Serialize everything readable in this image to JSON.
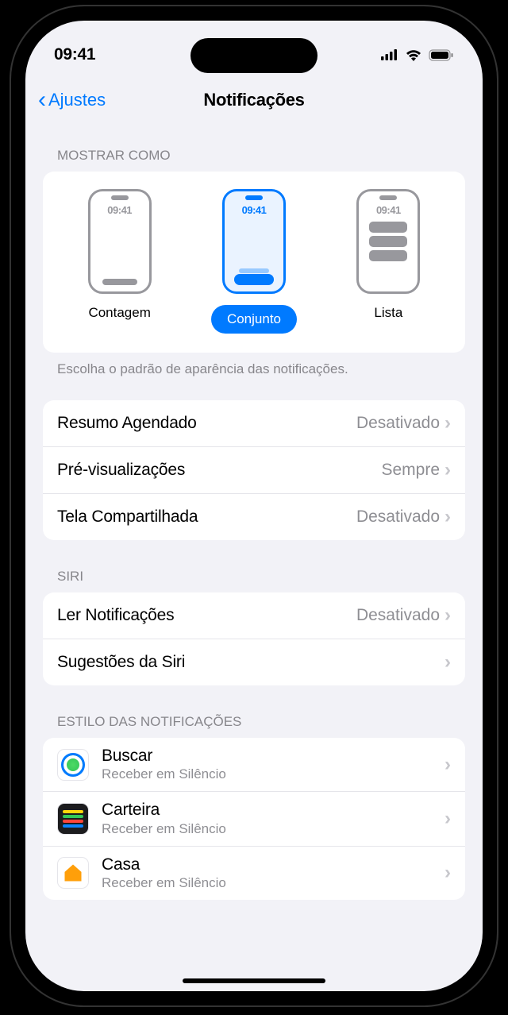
{
  "status": {
    "time": "09:41"
  },
  "nav": {
    "back_label": "Ajustes",
    "title": "Notificações"
  },
  "show_as": {
    "header": "MOSTRAR COMO",
    "options": {
      "count": {
        "label": "Contagem",
        "phone_time": "09:41",
        "selected": false
      },
      "stack": {
        "label": "Conjunto",
        "phone_time": "09:41",
        "selected": true
      },
      "list": {
        "label": "Lista",
        "phone_time": "09:41",
        "selected": false
      }
    },
    "footer": "Escolha o padrão de aparência das notificações."
  },
  "settings_group": {
    "rows": {
      "scheduled_summary": {
        "title": "Resumo Agendado",
        "value": "Desativado"
      },
      "previews": {
        "title": "Pré-visualizações",
        "value": "Sempre"
      },
      "screen_sharing": {
        "title": "Tela Compartilhada",
        "value": "Desativado"
      }
    }
  },
  "siri_group": {
    "header": "SIRI",
    "rows": {
      "announce": {
        "title": "Ler Notificações",
        "value": "Desativado"
      },
      "suggestions": {
        "title": "Sugestões da Siri",
        "value": ""
      }
    }
  },
  "style_group": {
    "header": "ESTILO DAS NOTIFICAÇÕES",
    "apps": {
      "findmy": {
        "name": "Buscar",
        "sub": "Receber em Silêncio"
      },
      "wallet": {
        "name": "Carteira",
        "sub": "Receber em Silêncio"
      },
      "home": {
        "name": "Casa",
        "sub": "Receber em Silêncio"
      }
    }
  }
}
